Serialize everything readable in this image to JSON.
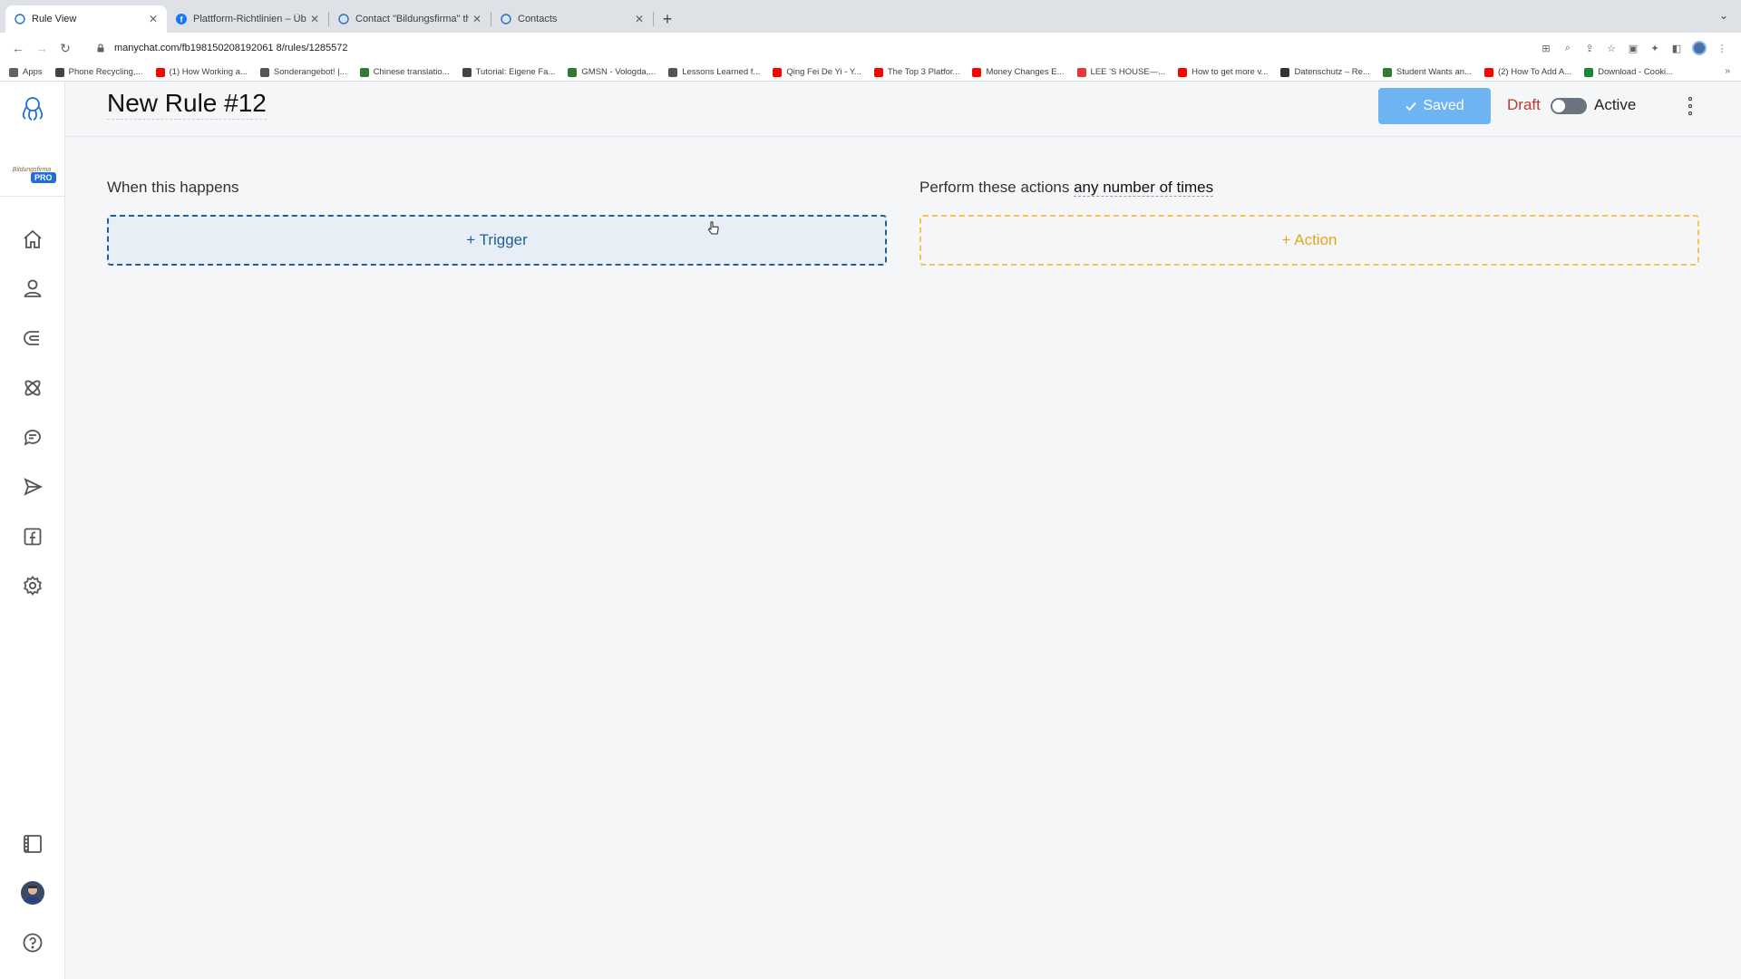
{
  "browser": {
    "tabs": [
      {
        "title": "Rule View",
        "active": true
      },
      {
        "title": "Plattform-Richtlinien – Übersicht",
        "active": false
      },
      {
        "title": "Contact \"Bildungsfirma\" through",
        "active": false
      },
      {
        "title": "Contacts",
        "active": false
      }
    ],
    "url": "manychat.com/fb198150208192061 8/rules/1285572",
    "bookmarks": [
      {
        "label": "Apps",
        "color": "#5f6368"
      },
      {
        "label": "Phone Recycling,...",
        "color": "#444444"
      },
      {
        "label": "(1) How Working a...",
        "color": "#ff0000"
      },
      {
        "label": "Sonderangebot! |...",
        "color": "#555555"
      },
      {
        "label": "Chinese translatio...",
        "color": "#2e7d32"
      },
      {
        "label": "Tutorial: Eigene Fa...",
        "color": "#444444"
      },
      {
        "label": "GMSN - Vologda,...",
        "color": "#2e7d32"
      },
      {
        "label": "Lessons Learned f...",
        "color": "#555555"
      },
      {
        "label": "Qing Fei De Yi - Y...",
        "color": "#ff0000"
      },
      {
        "label": "The Top 3 Platfor...",
        "color": "#ff0000"
      },
      {
        "label": "Money Changes E...",
        "color": "#ff0000"
      },
      {
        "label": "LEE 'S HOUSE—...",
        "color": "#e53935"
      },
      {
        "label": "How to get more v...",
        "color": "#ff0000"
      },
      {
        "label": "Datenschutz – Re...",
        "color": "#333333"
      },
      {
        "label": "Student Wants an...",
        "color": "#2e7d32"
      },
      {
        "label": "(2) How To Add A...",
        "color": "#ff0000"
      },
      {
        "label": "Download - Cooki...",
        "color": "#1b8a3a"
      }
    ]
  },
  "sidebar": {
    "pro_badge": "PRO",
    "account_logo_text": "Bildungsfirma",
    "items": [
      {
        "icon": "home-icon"
      },
      {
        "icon": "contacts-icon"
      },
      {
        "icon": "growth-tools-icon"
      },
      {
        "icon": "automation-icon"
      },
      {
        "icon": "live-chat-icon"
      },
      {
        "icon": "broadcasting-icon"
      },
      {
        "icon": "facebook-icon"
      },
      {
        "icon": "settings-icon"
      },
      {
        "icon": "templates-icon"
      },
      {
        "icon": "avatar"
      },
      {
        "icon": "help-icon"
      }
    ]
  },
  "header": {
    "rule_title": "New Rule #12",
    "saved_label": "Saved",
    "draft_label": "Draft",
    "active_label": "Active"
  },
  "rule": {
    "trigger_section_label": "When this happens",
    "action_section_prefix": "Perform these actions",
    "action_frequency": "any number of times",
    "trigger_button": "+ Trigger",
    "action_button": "+ Action"
  },
  "colors": {
    "accent": "#1f5f9e",
    "saved": "#6fb4f2",
    "draft": "#c0392b",
    "action": "#f5c452"
  }
}
